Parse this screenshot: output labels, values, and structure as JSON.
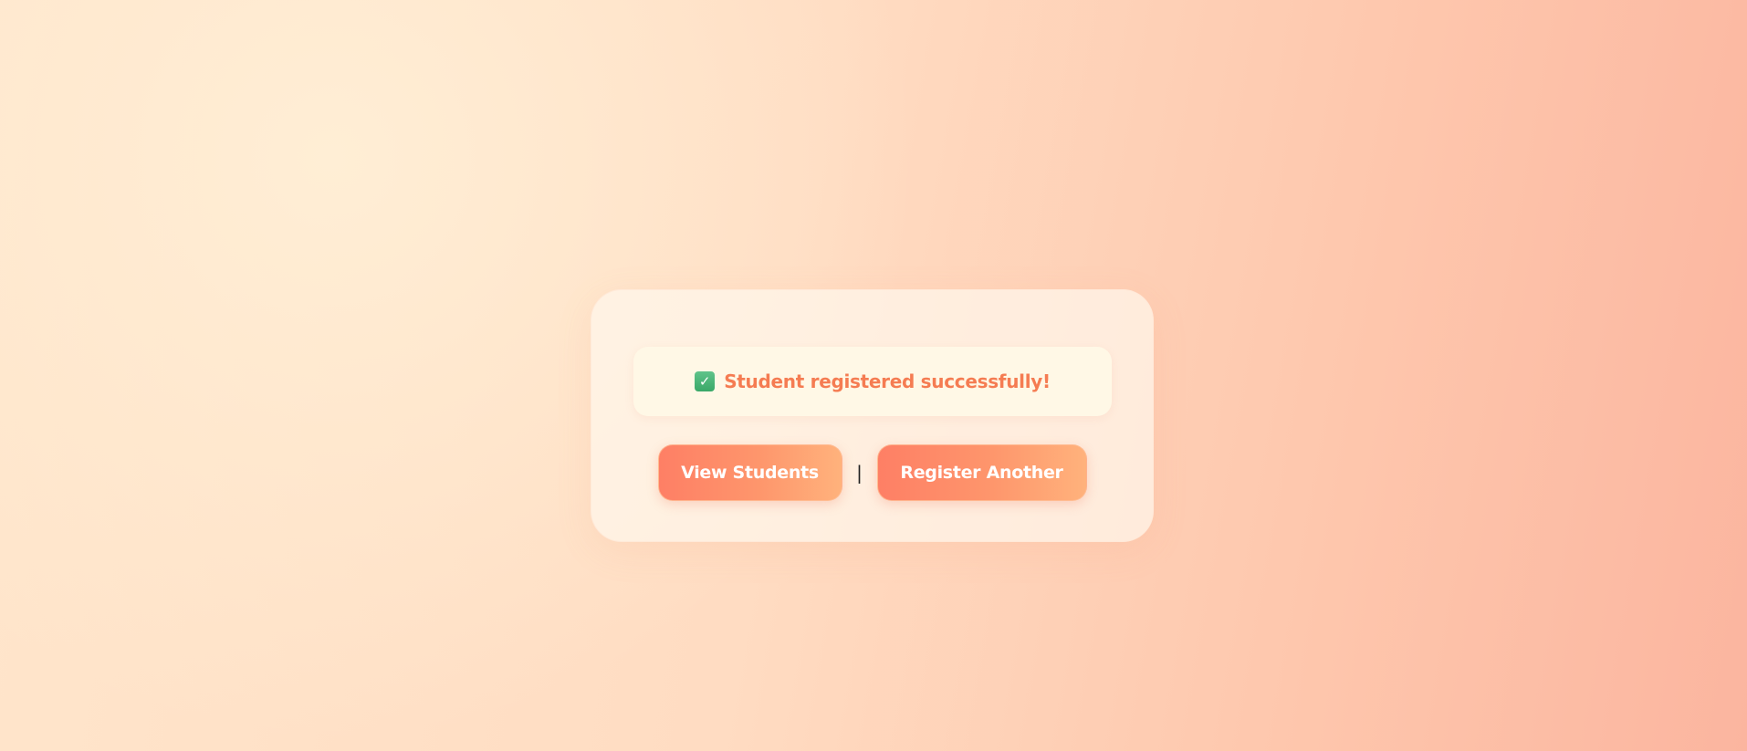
{
  "message": {
    "icon": "check-box-icon",
    "text": "Student registered successfully!",
    "text_color": "#f57c52"
  },
  "actions": {
    "view_students_label": "View Students",
    "separator": "|",
    "register_another_label": "Register Another",
    "button_gradient_start": "#fe7f65",
    "button_gradient_end": "#ffb27c"
  }
}
